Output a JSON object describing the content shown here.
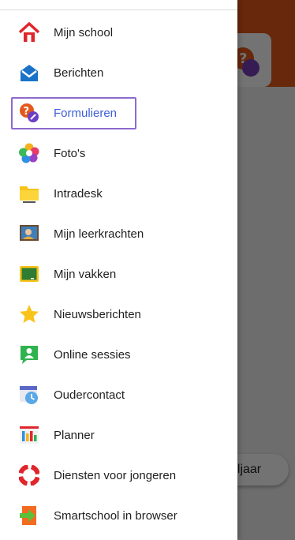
{
  "background": {
    "chip_label": "oljaar"
  },
  "menu": {
    "items": [
      {
        "label": "Mijn school",
        "icon": "house-icon"
      },
      {
        "label": "Berichten",
        "icon": "envelope-icon"
      },
      {
        "label": "Formulieren",
        "icon": "question-form-icon",
        "selected": true
      },
      {
        "label": "Foto's",
        "icon": "photos-flower-icon"
      },
      {
        "label": "Intradesk",
        "icon": "folder-icon"
      },
      {
        "label": "Mijn leerkrachten",
        "icon": "teacher-board-icon"
      },
      {
        "label": "Mijn vakken",
        "icon": "chalkboard-icon"
      },
      {
        "label": "Nieuwsberichten",
        "icon": "star-icon"
      },
      {
        "label": "Online sessies",
        "icon": "video-person-icon"
      },
      {
        "label": "Oudercontact",
        "icon": "calendar-clock-icon"
      },
      {
        "label": "Planner",
        "icon": "planner-icon"
      },
      {
        "label": "Diensten voor jongeren",
        "icon": "lifebuoy-icon"
      },
      {
        "label": "Smartschool in browser",
        "icon": "browser-arrow-icon"
      }
    ]
  },
  "colors": {
    "selected_text": "#3d5fd8",
    "selection_border": "#8c6ad0",
    "header_orange": "#e4591b"
  }
}
